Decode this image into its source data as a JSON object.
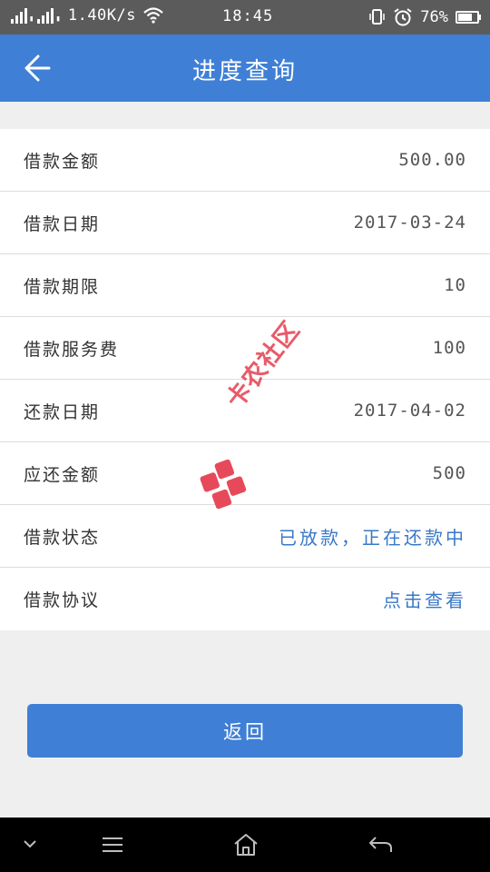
{
  "status_bar": {
    "speed": "1.40K/s",
    "time": "18:45",
    "battery": "76%",
    "battery_level": 0.76
  },
  "header": {
    "title": "进度查询"
  },
  "details": [
    {
      "label": "借款金额",
      "value": "500.00"
    },
    {
      "label": "借款日期",
      "value": "2017-03-24"
    },
    {
      "label": "借款期限",
      "value": "10"
    },
    {
      "label": "借款服务费",
      "value": "100"
    },
    {
      "label": "还款日期",
      "value": "2017-04-02"
    },
    {
      "label": "应还金额",
      "value": "500"
    },
    {
      "label": "借款状态",
      "value": "已放款，正在还款中"
    },
    {
      "label": "借款协议",
      "value": "点击查看"
    }
  ],
  "return_button": {
    "label": "返回"
  },
  "watermark": {
    "text": "卡农社区"
  },
  "colors": {
    "primary": "#3f7fd6",
    "link": "#3a78c8",
    "watermark": "#e64a5a"
  }
}
